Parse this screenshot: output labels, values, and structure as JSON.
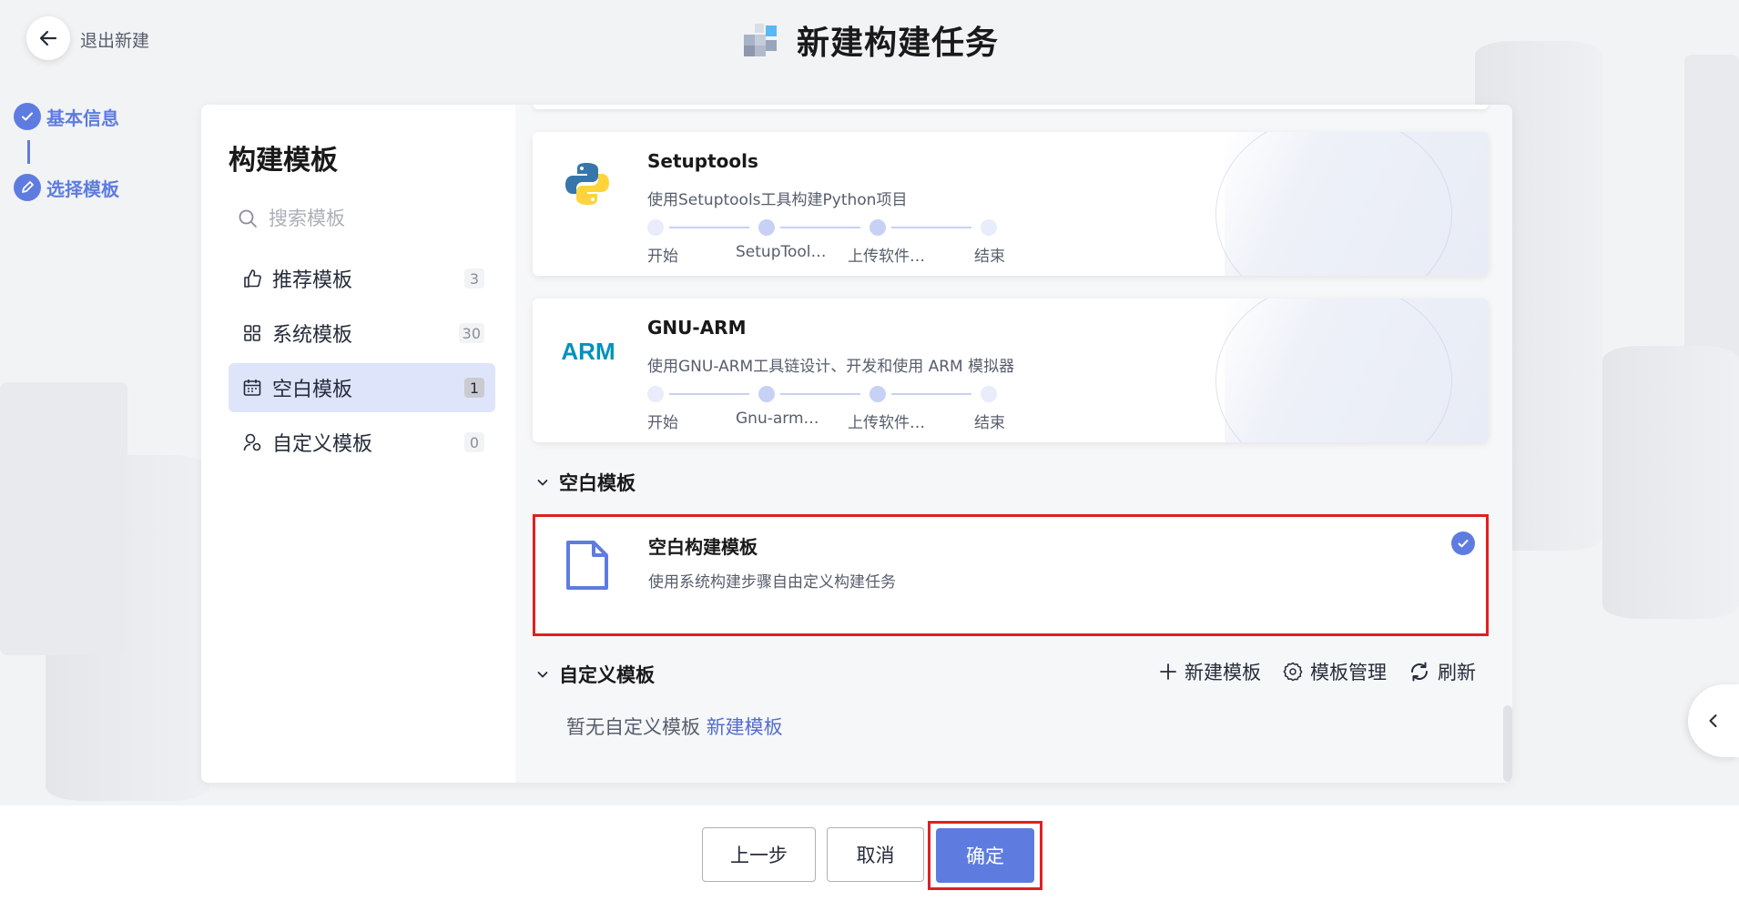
{
  "header": {
    "back_label": "退出新建",
    "title": "新建构建任务"
  },
  "steps": [
    {
      "label": "基本信息",
      "status": "done"
    },
    {
      "label": "选择模板",
      "status": "current"
    }
  ],
  "sidebar": {
    "title": "构建模板",
    "search_placeholder": "搜索模板",
    "categories": [
      {
        "label": "推荐模板",
        "count": "3",
        "icon": "thumbs-up-icon"
      },
      {
        "label": "系统模板",
        "count": "30",
        "icon": "grid-icon"
      },
      {
        "label": "空白模板",
        "count": "1",
        "icon": "calendar-icon",
        "active": true
      },
      {
        "label": "自定义模板",
        "count": "0",
        "icon": "user-template-icon"
      }
    ]
  },
  "templates": [
    {
      "name": "Setuptools",
      "desc": "使用Setuptools工具构建Python项目",
      "icon": "python-logo",
      "flow": [
        "开始",
        "SetupTool…",
        "上传软件…",
        "结束"
      ]
    },
    {
      "name": "GNU-ARM",
      "desc": "使用GNU-ARM工具链设计、开发和使用 ARM 模拟器",
      "icon": "arm-logo",
      "logo_text": "ARM",
      "flow": [
        "开始",
        "Gnu-arm…",
        "上传软件…",
        "结束"
      ]
    }
  ],
  "blank_section": {
    "title": "空白模板",
    "card": {
      "name": "空白构建模板",
      "desc": "使用系统构建步骤自由定义构建任务",
      "selected": true
    }
  },
  "custom_section": {
    "title": "自定义模板",
    "actions": [
      {
        "label": "新建模板",
        "icon": "plus-icon"
      },
      {
        "label": "模板管理",
        "icon": "gear-icon"
      },
      {
        "label": "刷新",
        "icon": "refresh-icon"
      }
    ],
    "empty_text": "暂无自定义模板",
    "empty_link": "新建模板"
  },
  "footer": {
    "prev": "上一步",
    "cancel": "取消",
    "ok": "确定"
  },
  "colors": {
    "accent": "#5e7ce0",
    "highlight": "#e02020"
  }
}
